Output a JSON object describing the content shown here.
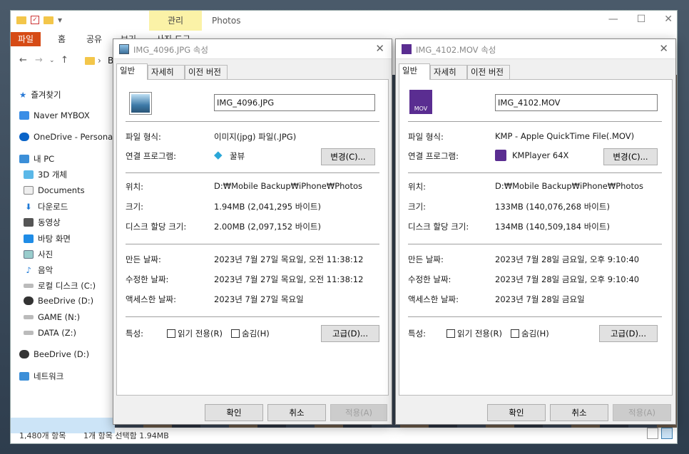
{
  "explorer": {
    "ribbon_context_tab": "관리",
    "title": "Photos",
    "tabs": [
      "파일",
      "홈",
      "공유",
      "보기",
      "사진 도구"
    ],
    "address_partial": "B",
    "nav": [
      {
        "label": "즐겨찾기",
        "icon": "star-icon"
      },
      {
        "label": "Naver MYBOX",
        "icon": "cloud-box-icon"
      },
      {
        "label": "OneDrive - Personal",
        "icon": "onedrive-icon"
      },
      {
        "label": "내 PC",
        "icon": "pc-icon"
      },
      {
        "label": "3D 개체",
        "icon": "cube-icon"
      },
      {
        "label": "Documents",
        "icon": "document-icon"
      },
      {
        "label": "다운로드",
        "icon": "download-icon"
      },
      {
        "label": "동영상",
        "icon": "video-icon"
      },
      {
        "label": "바탕 화면",
        "icon": "desktop-icon"
      },
      {
        "label": "사진",
        "icon": "pictures-icon"
      },
      {
        "label": "음악",
        "icon": "music-icon"
      },
      {
        "label": "로컬 디스크 (C:)",
        "icon": "drive-icon"
      },
      {
        "label": "BeeDrive (D:)",
        "icon": "beedrive-icon"
      },
      {
        "label": "GAME (N:)",
        "icon": "drive-icon"
      },
      {
        "label": "DATA (Z:)",
        "icon": "drive-icon"
      },
      {
        "label": "BeeDrive (D:)",
        "icon": "beedrive-icon"
      },
      {
        "label": "네트워크",
        "icon": "network-icon"
      }
    ],
    "status_count": "1,480개 항목",
    "status_selected": "1개 항목 선택함 1.94MB"
  },
  "dialog1": {
    "title": "IMG_4096.JPG 속성",
    "tabs": [
      "일반",
      "자세히",
      "이전 버전"
    ],
    "filename": "IMG_4096.JPG",
    "labels": {
      "type": "파일 형식:",
      "opens_with": "연결 프로그램:",
      "location": "위치:",
      "size": "크기:",
      "size_on_disk": "디스크 할당 크기:",
      "created": "만든 날짜:",
      "modified": "수정한 날짜:",
      "accessed": "액세스한 날짜:",
      "attributes": "특성:"
    },
    "type": "이미지(jpg) 파일(.JPG)",
    "opens_with": "꿀뷰",
    "change_button": "변경(C)...",
    "location": "D:₩Mobile Backup₩iPhone₩Photos",
    "size": "1.94MB (2,041,295 바이트)",
    "size_on_disk": "2.00MB (2,097,152 바이트)",
    "created": "2023년 7월 27일 목요일, 오전 11:38:12",
    "modified": "2023년 7월 27일 목요일, 오전 11:38:12",
    "accessed": "2023년 7월 27일 목요일",
    "readonly_label": "읽기 전용(R)",
    "hidden_label": "숨김(H)",
    "advanced_button": "고급(D)...",
    "ok": "확인",
    "cancel": "취소",
    "apply": "적용(A)"
  },
  "dialog2": {
    "title": "IMG_4102.MOV 속성",
    "tabs": [
      "일반",
      "자세히",
      "이전 버전"
    ],
    "filename": "IMG_4102.MOV",
    "icon_text": "MOV",
    "type": "KMP - Apple QuickTime File(.MOV)",
    "opens_with": "KMPlayer 64X",
    "change_button": "변경(C)...",
    "location": "D:₩Mobile Backup₩iPhone₩Photos",
    "size": "133MB (140,076,268 바이트)",
    "size_on_disk": "134MB (140,509,184 바이트)",
    "created": "2023년 7월 28일 금요일, 오후 9:10:40",
    "modified": "2023년 7월 28일 금요일, 오후 9:10:40",
    "accessed": "2023년 7월 28일 금요일",
    "readonly_label": "읽기 전용(R)",
    "hidden_label": "숨김(H)",
    "advanced_button": "고급(D)...",
    "ok": "확인",
    "cancel": "취소",
    "apply": "적용(A)"
  }
}
